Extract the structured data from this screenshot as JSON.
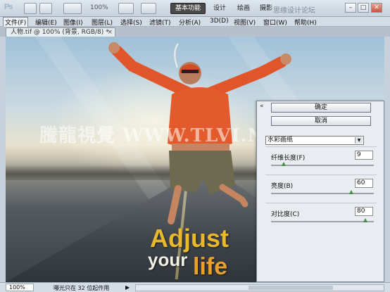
{
  "app": {
    "logo": "Ps",
    "zoom_display": "100%"
  },
  "workspace": {
    "buttons": [
      "基本功能",
      "设计",
      "绘画",
      "摄影"
    ],
    "watermark": "思缘设计论坛"
  },
  "window_controls": {
    "minimize": "–",
    "restore": "□",
    "close": "✕"
  },
  "menu": [
    "文件(F)",
    "编辑(E)",
    "图像(I)",
    "图层(L)",
    "选择(S)",
    "滤镜(T)",
    "分析(A)",
    "3D(D)",
    "视图(V)",
    "窗口(W)",
    "帮助(H)"
  ],
  "document": {
    "tab_title": "人物.tif @ 100% (背景, RGB/8) *",
    "close": "×"
  },
  "canvas": {
    "watermark": "騰龍視覺 WWW.TLVI.NET",
    "poster_line1": "Adjust",
    "poster_line2": "your",
    "poster_line3": "life"
  },
  "dialog": {
    "collapse_icon": "«",
    "ok_label": "确定",
    "cancel_label": "取消",
    "filter_name": "水彩画纸",
    "params": [
      {
        "label": "纤维长度(F)",
        "value": "9",
        "fraction": 0.12
      },
      {
        "label": "亮度(B)",
        "value": "60",
        "fraction": 0.78
      },
      {
        "label": "对比度(C)",
        "value": "80",
        "fraction": 0.92
      }
    ]
  },
  "status": {
    "zoom": "100%",
    "info": "曝光只在 32 位起作用",
    "arrow": "▶"
  }
}
